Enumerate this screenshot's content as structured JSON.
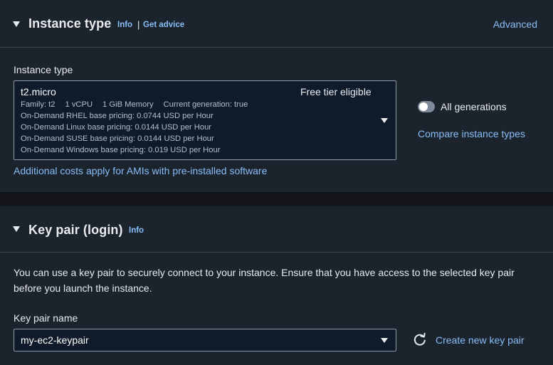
{
  "instance_type_section": {
    "title": "Instance type",
    "info_label": "Info",
    "separator": "|",
    "advice_label": "Get advice",
    "advanced_label": "Advanced",
    "field_label": "Instance type",
    "selected": {
      "name": "t2.micro",
      "badge": "Free tier eligible",
      "family": "Family: t2",
      "vcpu": "1 vCPU",
      "memory": "1 GiB Memory",
      "generation": "Current generation: true",
      "pricing": [
        "On-Demand RHEL base pricing: 0.0744 USD per Hour",
        "On-Demand Linux base pricing: 0.0144 USD per Hour",
        "On-Demand SUSE base pricing: 0.0144 USD per Hour",
        "On-Demand Windows base pricing: 0.019 USD per Hour"
      ]
    },
    "toggle_label": "All generations",
    "toggle_on": false,
    "compare_label": "Compare instance types",
    "additional_costs_label": "Additional costs apply for AMIs with pre-installed software"
  },
  "key_pair_section": {
    "title": "Key pair (login)",
    "info_label": "Info",
    "description": "You can use a key pair to securely connect to your instance. Ensure that you have access to the selected key pair before you launch the instance.",
    "field_label": "Key pair name",
    "selected_value": "my-ec2-keypair",
    "create_label": "Create new key pair"
  },
  "icons": {
    "section_caret": "caret-down-icon",
    "select_caret": "dropdown-caret-icon",
    "refresh": "refresh-icon"
  },
  "colors": {
    "background": "#151619",
    "panel": "#1b232d",
    "link": "#89bdf6",
    "text": "#e9ebed",
    "select_border": "#8d99a8",
    "toggle_off": "#7d8998"
  }
}
